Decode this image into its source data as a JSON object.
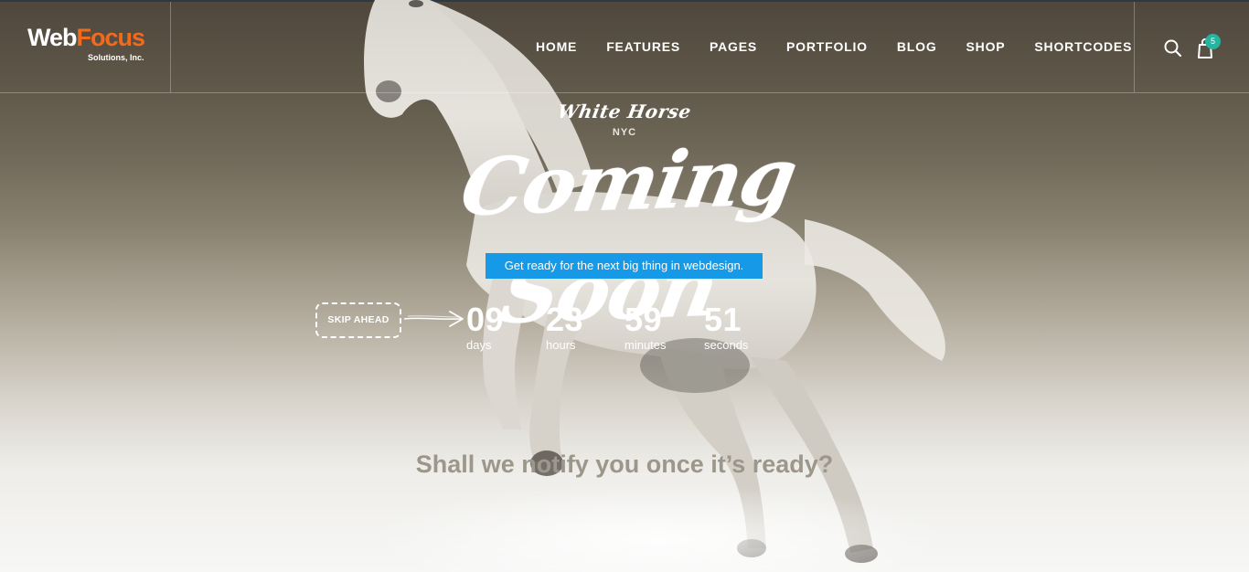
{
  "header": {
    "logo": {
      "part1": "Web",
      "part2": "Focus",
      "subtitle": "Solutions, Inc."
    },
    "nav": [
      "HOME",
      "FEATURES",
      "PAGES",
      "PORTFOLIO",
      "BLOG",
      "SHOP",
      "SHORTCODES"
    ],
    "cart_count": "5",
    "icons": {
      "search": "search-icon",
      "cart": "shopping-bag-icon"
    }
  },
  "hero": {
    "brand": "White Horse",
    "brand_city": "NYC",
    "headline": "Coming Soon",
    "tagline": "Get ready for the next big thing in webdesign.",
    "skip_label": "SKIP AHEAD",
    "countdown": {
      "days": {
        "value": "09",
        "label": "days"
      },
      "hours": {
        "value": "23",
        "label": "hours"
      },
      "minutes": {
        "value": "59",
        "label": "minutes"
      },
      "seconds": {
        "value": "51",
        "label": "seconds"
      }
    },
    "notify": "Shall we notify you once it’s ready?"
  },
  "colors": {
    "accent": "#1699e6",
    "logo_orange": "#f26a1b",
    "badge": "#27b3a0"
  }
}
